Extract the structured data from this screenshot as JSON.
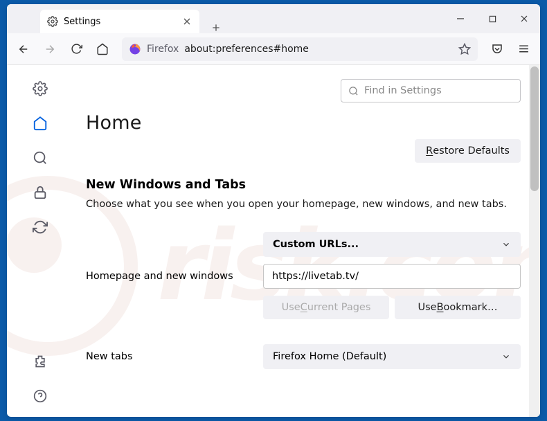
{
  "titlebar": {
    "tab_title": "Settings"
  },
  "urlbar": {
    "label": "Firefox",
    "path": "about:preferences#home"
  },
  "search": {
    "placeholder": "Find in Settings"
  },
  "page": {
    "heading": "Home",
    "restore_defaults": "Restore Defaults",
    "restore_underline": "R",
    "restore_rest": "estore Defaults",
    "section_title": "New Windows and Tabs",
    "section_desc": "Choose what you see when you open your homepage, new windows, and new tabs."
  },
  "form": {
    "homepage_select_value": "Custom URLs...",
    "homepage_label": "Homepage and new windows",
    "homepage_input_value": "https://livetab.tv/",
    "use_current_pre": "Use ",
    "use_current_u": "C",
    "use_current_post": "urrent Pages",
    "use_bookmark_pre": "Use ",
    "use_bookmark_u": "B",
    "use_bookmark_post": "ookmark…",
    "newtabs_label": "New tabs",
    "newtabs_select_value": "Firefox Home (Default)"
  }
}
